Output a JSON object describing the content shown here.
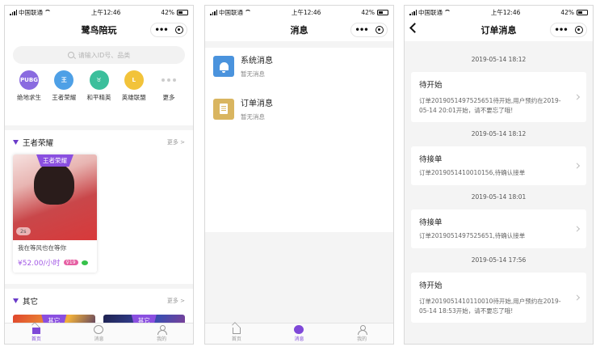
{
  "status_bar": {
    "carrier": "中国联通",
    "time": "上午12:46",
    "battery": "42%"
  },
  "screen1": {
    "title": "鹭鸟陪玩",
    "search_placeholder": "请输入ID号、品类",
    "games": [
      {
        "label": "绝地求生",
        "icon": "pubg-icon",
        "color": "#8a6be0",
        "abbr": "PUBG"
      },
      {
        "label": "王者荣耀",
        "icon": "honor-of-kings-icon",
        "color": "#4ea0e6",
        "abbr": "王"
      },
      {
        "label": "和平精英",
        "icon": "peace-elite-icon",
        "color": "#3cbf9c",
        "abbr": "♉"
      },
      {
        "label": "英雄联盟",
        "icon": "lol-icon",
        "color": "#f2c33a",
        "abbr": "L"
      },
      {
        "label": "更多",
        "icon": "more-icon"
      }
    ],
    "section1": {
      "title": "王者荣耀",
      "more": "更多 >"
    },
    "card": {
      "tag": "王者荣耀",
      "voice": "2s",
      "desc": "我在等风也在等你",
      "price": "¥52.00/小时",
      "age": "♀19"
    },
    "section2": {
      "title": "其它",
      "more": "更多 >",
      "tags": [
        "其它",
        "其它"
      ]
    },
    "tabs": [
      "首页",
      "消息",
      "我的"
    ]
  },
  "screen2": {
    "title": "消息",
    "items": [
      {
        "title": "系统消息",
        "sub": "暂无消息"
      },
      {
        "title": "订单消息",
        "sub": "暂无消息"
      }
    ],
    "tabs": [
      "首页",
      "消息",
      "我的"
    ]
  },
  "screen3": {
    "title": "订单消息",
    "orders": [
      {
        "time": "2019-05-14 18:12",
        "title": "待开始",
        "desc": "订单20190514975256​51待开始,用户预约在2019-05-14 20:01开始，请不要忘了哦!"
      },
      {
        "time": "2019-05-14 18:12",
        "title": "待接单",
        "desc": "订单20190514100101​56,待确认接单"
      },
      {
        "time": "2019-05-14 18:01",
        "title": "待接单",
        "desc": "订单20190514975256​51,待确认接单"
      },
      {
        "time": "2019-05-14 17:56",
        "title": "待开始",
        "desc": "订单20190514101100​10待开始,用户预约在2019-05-14 18:53开始，请不要忘了哦!"
      }
    ]
  }
}
